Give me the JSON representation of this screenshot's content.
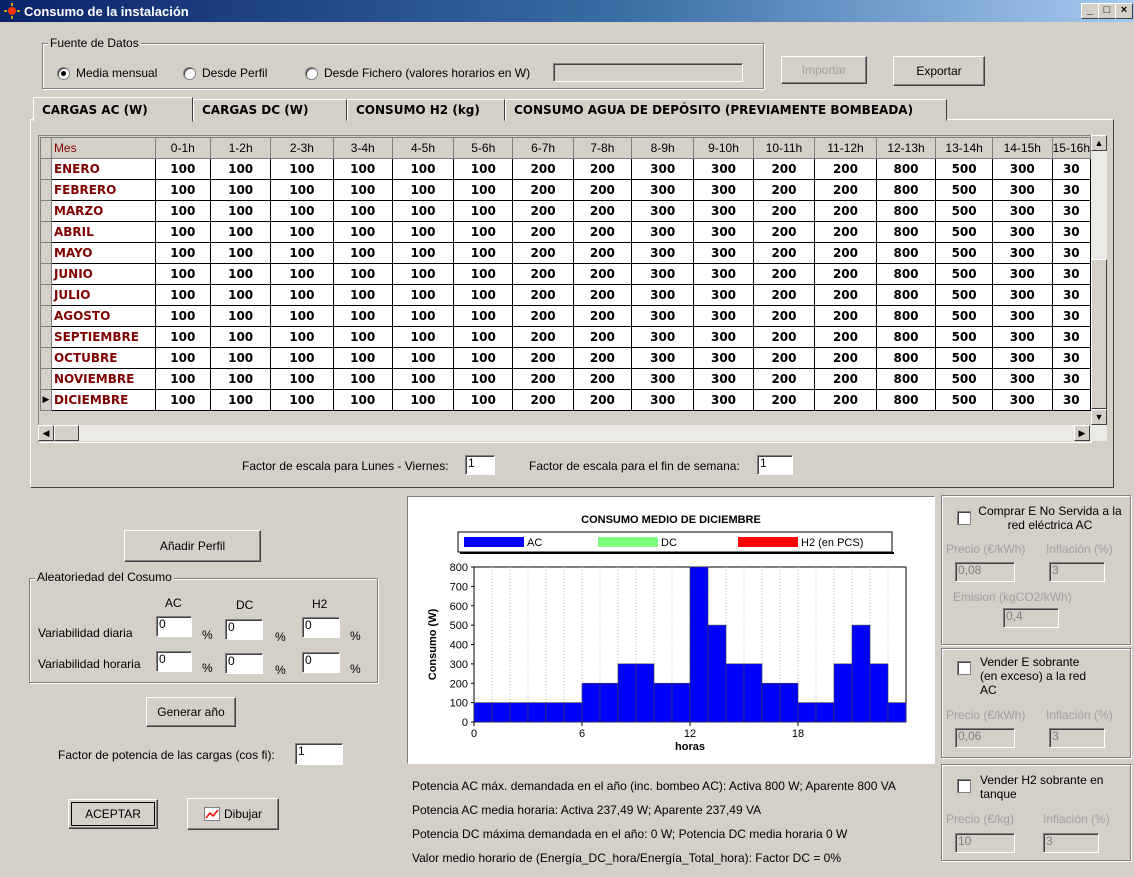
{
  "window": {
    "title": "Consumo de la instalación"
  },
  "fuente": {
    "label": "Fuente de Datos",
    "options": [
      "Media mensual",
      "Desde Perfil",
      "Desde Fichero (valores horarios en W)"
    ],
    "selected_index": 0,
    "file_value": "",
    "importar": "Importar",
    "exportar": "Exportar"
  },
  "tabs": [
    "CARGAS AC (W)",
    "CARGAS DC (W)",
    "CONSUMO H2 (kg)",
    "CONSUMO AGUA DE DEPÓSITO (PREVIAMENTE BOMBEADA)"
  ],
  "grid": {
    "headers": [
      "Mes",
      "0-1h",
      "1-2h",
      "2-3h",
      "3-4h",
      "4-5h",
      "5-6h",
      "6-7h",
      "7-8h",
      "8-9h",
      "9-10h",
      "10-11h",
      "11-12h",
      "12-13h",
      "13-14h",
      "14-15h",
      "15-16h"
    ],
    "rows": [
      {
        "mes": "ENERO",
        "v": [
          "100",
          "100",
          "100",
          "100",
          "100",
          "100",
          "200",
          "200",
          "300",
          "300",
          "200",
          "200",
          "800",
          "500",
          "300",
          "30"
        ]
      },
      {
        "mes": "FEBRERO",
        "v": [
          "100",
          "100",
          "100",
          "100",
          "100",
          "100",
          "200",
          "200",
          "300",
          "300",
          "200",
          "200",
          "800",
          "500",
          "300",
          "30"
        ]
      },
      {
        "mes": "MARZO",
        "v": [
          "100",
          "100",
          "100",
          "100",
          "100",
          "100",
          "200",
          "200",
          "300",
          "300",
          "200",
          "200",
          "800",
          "500",
          "300",
          "30"
        ]
      },
      {
        "mes": "ABRIL",
        "v": [
          "100",
          "100",
          "100",
          "100",
          "100",
          "100",
          "200",
          "200",
          "300",
          "300",
          "200",
          "200",
          "800",
          "500",
          "300",
          "30"
        ]
      },
      {
        "mes": "MAYO",
        "v": [
          "100",
          "100",
          "100",
          "100",
          "100",
          "100",
          "200",
          "200",
          "300",
          "300",
          "200",
          "200",
          "800",
          "500",
          "300",
          "30"
        ]
      },
      {
        "mes": "JUNIO",
        "v": [
          "100",
          "100",
          "100",
          "100",
          "100",
          "100",
          "200",
          "200",
          "300",
          "300",
          "200",
          "200",
          "800",
          "500",
          "300",
          "30"
        ]
      },
      {
        "mes": "JULIO",
        "v": [
          "100",
          "100",
          "100",
          "100",
          "100",
          "100",
          "200",
          "200",
          "300",
          "300",
          "200",
          "200",
          "800",
          "500",
          "300",
          "30"
        ]
      },
      {
        "mes": "AGOSTO",
        "v": [
          "100",
          "100",
          "100",
          "100",
          "100",
          "100",
          "200",
          "200",
          "300",
          "300",
          "200",
          "200",
          "800",
          "500",
          "300",
          "30"
        ]
      },
      {
        "mes": "SEPTIEMBRE",
        "v": [
          "100",
          "100",
          "100",
          "100",
          "100",
          "100",
          "200",
          "200",
          "300",
          "300",
          "200",
          "200",
          "800",
          "500",
          "300",
          "30"
        ]
      },
      {
        "mes": "OCTUBRE",
        "v": [
          "100",
          "100",
          "100",
          "100",
          "100",
          "100",
          "200",
          "200",
          "300",
          "300",
          "200",
          "200",
          "800",
          "500",
          "300",
          "30"
        ]
      },
      {
        "mes": "NOVIEMBRE",
        "v": [
          "100",
          "100",
          "100",
          "100",
          "100",
          "100",
          "200",
          "200",
          "300",
          "300",
          "200",
          "200",
          "800",
          "500",
          "300",
          "30"
        ]
      },
      {
        "mes": "DICIEMBRE",
        "v": [
          "100",
          "100",
          "100",
          "100",
          "100",
          "100",
          "200",
          "200",
          "300",
          "300",
          "200",
          "200",
          "800",
          "500",
          "300",
          "30"
        ]
      }
    ]
  },
  "escala": {
    "lv_label": "Factor de escala para  Lunes - Viernes:",
    "lv_value": "1",
    "fs_label": "Factor de escala para el fin de semana:",
    "fs_value": "1"
  },
  "left": {
    "anadir": "Añadir Perfil",
    "aleat_label": "Aleatoriedad del Cosumo",
    "col_ac": "AC",
    "col_dc": "DC",
    "col_h2": "H2",
    "var_diaria": "Variabilidad diaria",
    "var_horaria": "Variabilidad horaria",
    "pct": "%",
    "vd": [
      "0",
      "0",
      "0"
    ],
    "vh": [
      "0",
      "0",
      "0"
    ],
    "generar": "Generar año",
    "fp_label": "Factor de potencia de las cargas (cos fi):",
    "fp_value": "1",
    "aceptar": "ACEPTAR",
    "dibujar": "Dibujar"
  },
  "chart_data": {
    "type": "bar",
    "title": "CONSUMO MEDIO DE DICIEMBRE",
    "xlabel": "horas",
    "ylabel": "Consumo (W)",
    "ylim": [
      0,
      800
    ],
    "yticks": [
      "0",
      "100",
      "200",
      "300",
      "400",
      "500",
      "600",
      "700",
      "800"
    ],
    "xticks": [
      "0",
      "6",
      "12",
      "18"
    ],
    "x": [
      0,
      1,
      2,
      3,
      4,
      5,
      6,
      7,
      8,
      9,
      10,
      11,
      12,
      13,
      14,
      15,
      16,
      17,
      18,
      19,
      20,
      21,
      22,
      23
    ],
    "legend": [
      "AC",
      "DC",
      "H2 (en PCS)"
    ],
    "legend_colors": [
      "#0000ff",
      "#80ff80",
      "#ff0000"
    ],
    "series": [
      {
        "name": "AC",
        "values": [
          100,
          100,
          100,
          100,
          100,
          100,
          200,
          200,
          300,
          300,
          200,
          200,
          800,
          500,
          300,
          300,
          200,
          200,
          100,
          100,
          300,
          500,
          300,
          100
        ]
      }
    ]
  },
  "info": [
    "Potencia AC máx. demandada en el año (inc. bombeo AC): Activa 800 W; Aparente 800 VA",
    "Potencia AC media horaria: Activa 237,49 W; Aparente 237,49 VA",
    "Potencia DC máxima demandada en el año: 0 W; Potencia DC media horaria 0 W",
    "Valor medio horario de (Energía_DC_hora/Energía_Total_hora): Factor DC = 0%"
  ],
  "right": {
    "comprar": {
      "label": "Comprar E No Servida a la red eléctrica AC",
      "precio_lbl": "Precio (€/kWh)",
      "infl_lbl": "Inflación (%)",
      "precio": "0,08",
      "infl": "3",
      "emision_lbl": "Emision (kgCO2/kWh)",
      "emision": "0,4"
    },
    "vender_e": {
      "label": "Vender E sobrante (en exceso) a la red AC",
      "precio_lbl": "Precio (€/kWh)",
      "infl_lbl": "Inflación (%)",
      "precio": "0,06",
      "infl": "3"
    },
    "vender_h2": {
      "label": "Vender H2 sobrante en tanque",
      "precio_lbl": "Precio (€/kg)",
      "infl_lbl": "Inflación (%)",
      "precio": "10",
      "infl": "3"
    }
  }
}
